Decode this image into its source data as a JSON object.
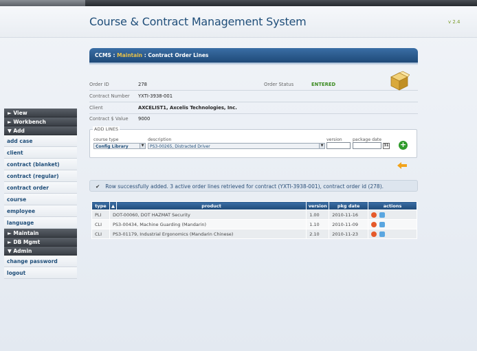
{
  "app": {
    "title": "Course & Contract Management System",
    "version": "v 2.4"
  },
  "sidebar": {
    "sections": [
      {
        "label": "► View"
      },
      {
        "label": "► Workbench"
      },
      {
        "label": "▼ Add"
      }
    ],
    "add_items": [
      "add case",
      "client",
      "contract (blanket)",
      "contract (regular)",
      "contract order",
      "course",
      "employee",
      "language"
    ],
    "maintain": "► Maintain",
    "dbmgmt": "► DB Mgmt",
    "admin": "▼ Admin",
    "admin_items": [
      "change password",
      "logout"
    ]
  },
  "banner": {
    "prefix": "CCMS : ",
    "highlight": "Maintain",
    "suffix": " : Contract Order Lines"
  },
  "order": {
    "order_id_label": "Order ID",
    "order_id": "278",
    "status_label": "Order Status",
    "status": "ENTERED",
    "contract_number_label": "Contract Number",
    "contract_number": "YXTI-3938-001",
    "client_label": "Client",
    "client": "AXCELIST1, Axcelis Technologies, Inc.",
    "value_label": "Contract $ Value",
    "value": "9000"
  },
  "add_lines": {
    "legend": "ADD LINES",
    "course_type_label": "course type",
    "course_type_value": "Config Library",
    "description_label": "description",
    "description_value": "PS3-00265,   Distracted Driver",
    "version_label": "version",
    "package_date_label": "package date",
    "calendar_label": "31"
  },
  "message": {
    "check": "✔",
    "text": "Row successfully added.  3 active order lines retrieved for contract (YXTI-3938-001), contract order id (278)."
  },
  "grid": {
    "headers": {
      "type": "type",
      "sort": "▲",
      "product": "product",
      "version": "version",
      "pkg_date": "pkg date",
      "actions": "actions"
    },
    "rows": [
      {
        "type": "PLI",
        "product": "DOT-00060,   DOT HAZMAT Security",
        "version": "1.00",
        "pkg_date": "2010-11-16"
      },
      {
        "type": "CLI",
        "product": "PS3-00434,   Machine Guarding (Mandarin)",
        "version": "1.10",
        "pkg_date": "2010-11-09"
      },
      {
        "type": "CLI",
        "product": "PS3-01179,   Industrial Ergonomics (Mandarin Chinese)",
        "version": "2.10",
        "pkg_date": "2010-11-23"
      }
    ]
  },
  "colors": {
    "brand": "#1f4e79",
    "accent_green": "#3a8a1f",
    "banner_highlight": "#e8c14a"
  },
  "icons": {
    "delete": "delete-icon",
    "edit": "edit-icon",
    "add": "add-plus-icon",
    "back": "back-arrow-icon",
    "box": "package-box-icon"
  }
}
